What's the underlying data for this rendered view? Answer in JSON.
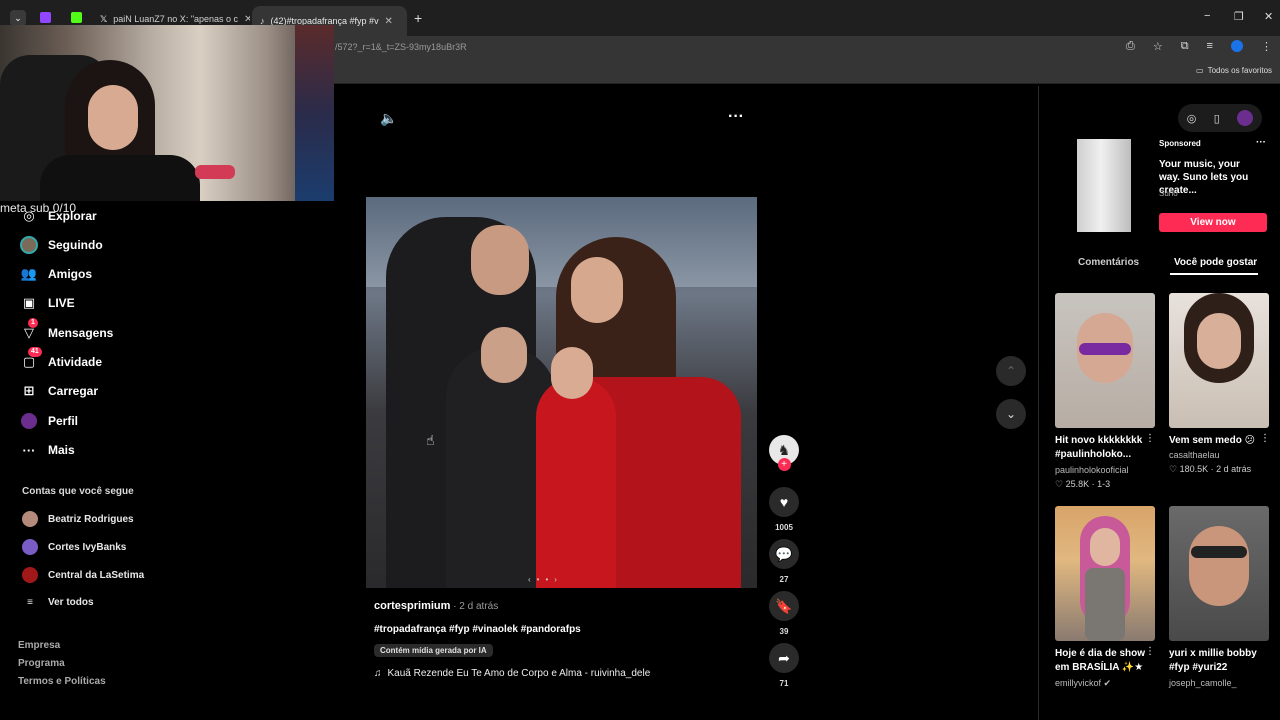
{
  "browser": {
    "tabs": [
      {
        "label": "paiN LuanZ7 no X: \"apenas o c"
      },
      {
        "label": "(42)#tropadafrança #fyp #vina"
      }
    ],
    "url": "/572?_r=1&_t=ZS-93my18uBr3R",
    "bookmarks_label": "Todos os favoritos"
  },
  "overlay_text": "meta sub 0/10",
  "nav": {
    "items": [
      {
        "label": "Explorar",
        "icon": "compass-icon"
      },
      {
        "label": "Seguindo",
        "icon": "following-avatar-icon"
      },
      {
        "label": "Amigos",
        "icon": "friends-icon"
      },
      {
        "label": "LIVE",
        "icon": "live-icon"
      },
      {
        "label": "Mensagens",
        "icon": "messages-icon",
        "badge": "1"
      },
      {
        "label": "Atividade",
        "icon": "activity-icon",
        "badge": "41"
      },
      {
        "label": "Carregar",
        "icon": "upload-icon"
      },
      {
        "label": "Perfil",
        "icon": "profile-icon"
      },
      {
        "label": "Mais",
        "icon": "more-icon"
      }
    ],
    "following_title": "Contas que você segue",
    "following": [
      {
        "name": "Beatriz Rodrigues",
        "color": "#b48a7a"
      },
      {
        "name": "Cortes IvyBanks",
        "color": "#7a5cc7"
      },
      {
        "name": "Central da LaSetima",
        "color": "#a01818"
      }
    ],
    "see_all": "Ver todos",
    "footer": [
      "Empresa",
      "Programa",
      "Termos e Políticas"
    ]
  },
  "video": {
    "author": "cortesprimium",
    "time": " · 2 d atrás",
    "hashtags": "#tropadafrança #fyp #vinaolek #pandorafps",
    "ai_label": "Contém mídia gerada por IA",
    "music": "Kauã Rezende Eu Te Amo de Corpo e Alma - ruivinha_dele",
    "likes": "1005",
    "comments": "27",
    "saves": "39",
    "shares": "71"
  },
  "ad": {
    "label": "Sponsored",
    "text": "Your music, your way. Suno lets you create...",
    "brand": "Suno",
    "button": "View now"
  },
  "right_tabs": {
    "comments": "Comentários",
    "suggested": "Você pode gostar"
  },
  "cards": [
    {
      "title": "Hit novo kkkkkkkk #paulinholoko...",
      "author": "paulinholokooficial",
      "stat": "♡ 25.8K · 1-3"
    },
    {
      "title": "Vem sem medo 😕",
      "author": "casalthaelau",
      "stat": "♡ 180.5K · 2 d atrás"
    },
    {
      "title": "Hoje é dia de show em BRASÍLIA ✨★",
      "author": "emillyvickof ✔",
      "stat": ""
    },
    {
      "title": "yuri x millie bobby #fyp #yuri22",
      "author": "joseph_camolle_",
      "stat": ""
    }
  ],
  "colors": {
    "accent": "#fe2c55",
    "background": "#000000"
  }
}
